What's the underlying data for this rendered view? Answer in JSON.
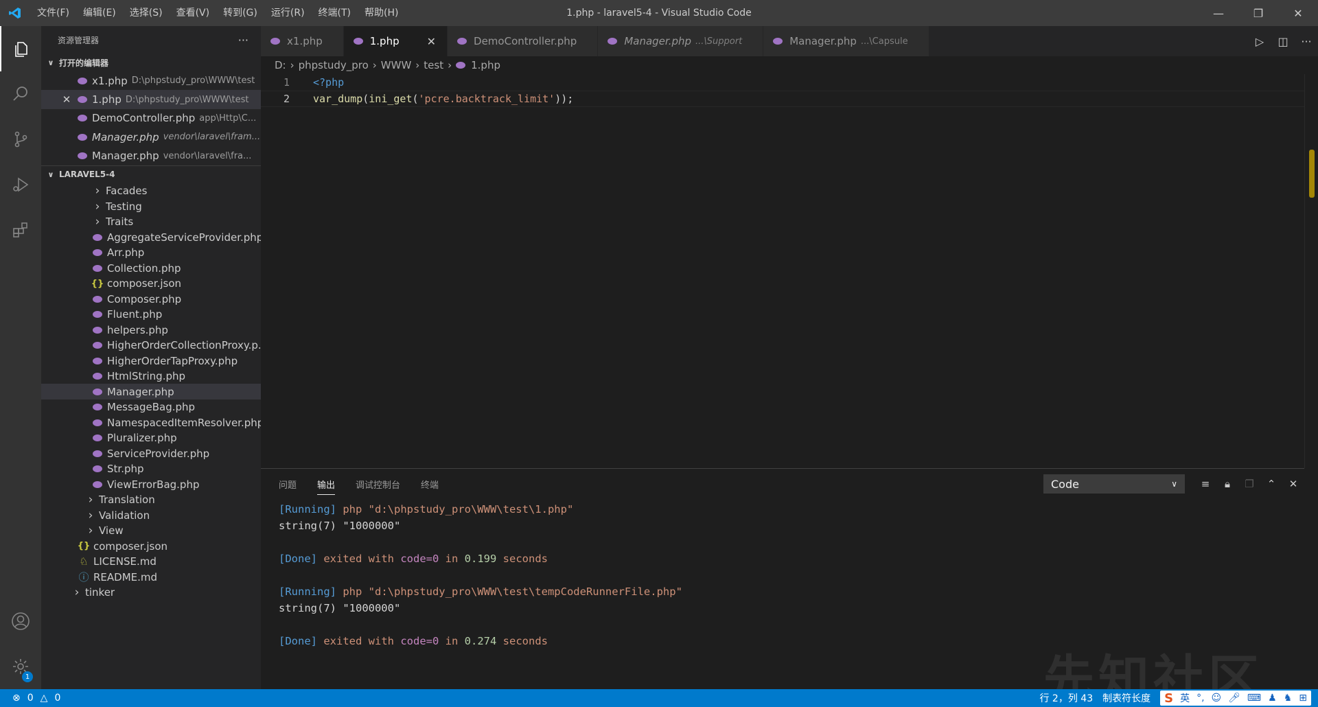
{
  "titlebar": {
    "menu": [
      "文件(F)",
      "编辑(E)",
      "选择(S)",
      "查看(V)",
      "转到(G)",
      "运行(R)",
      "终端(T)",
      "帮助(H)"
    ],
    "title": "1.php - laravel5-4 - Visual Studio Code"
  },
  "sidebar": {
    "header": "资源管理器",
    "open_editors_label": "打开的编辑器",
    "open_editors": [
      {
        "name": "x1.php",
        "desc": "D:\\phpstudy_pro\\WWW\\test",
        "italic": false
      },
      {
        "name": "1.php",
        "desc": "D:\\phpstudy_pro\\WWW\\test",
        "italic": false
      },
      {
        "name": "DemoController.php",
        "desc": "app\\Http\\C...",
        "italic": false
      },
      {
        "name": "Manager.php",
        "desc": "vendor\\laravel\\fram...",
        "italic": true
      },
      {
        "name": "Manager.php",
        "desc": "vendor\\laravel\\fra...",
        "italic": false
      }
    ],
    "project_label": "LARAVEL5-4",
    "tree": [
      {
        "name": "Facades",
        "kind": "folder",
        "indent": 1
      },
      {
        "name": "Testing",
        "kind": "folder",
        "indent": 1
      },
      {
        "name": "Traits",
        "kind": "folder",
        "indent": 1
      },
      {
        "name": "AggregateServiceProvider.php",
        "kind": "php",
        "indent": 1
      },
      {
        "name": "Arr.php",
        "kind": "php",
        "indent": 1
      },
      {
        "name": "Collection.php",
        "kind": "php",
        "indent": 1
      },
      {
        "name": "composer.json",
        "kind": "json",
        "indent": 1
      },
      {
        "name": "Composer.php",
        "kind": "php",
        "indent": 1
      },
      {
        "name": "Fluent.php",
        "kind": "php",
        "indent": 1
      },
      {
        "name": "helpers.php",
        "kind": "php",
        "indent": 1
      },
      {
        "name": "HigherOrderCollectionProxy.p...",
        "kind": "php",
        "indent": 1
      },
      {
        "name": "HigherOrderTapProxy.php",
        "kind": "php",
        "indent": 1
      },
      {
        "name": "HtmlString.php",
        "kind": "php",
        "indent": 1
      },
      {
        "name": "Manager.php",
        "kind": "php",
        "indent": 1,
        "selected": true
      },
      {
        "name": "MessageBag.php",
        "kind": "php",
        "indent": 1
      },
      {
        "name": "NamespacedItemResolver.php",
        "kind": "php",
        "indent": 1
      },
      {
        "name": "Pluralizer.php",
        "kind": "php",
        "indent": 1
      },
      {
        "name": "ServiceProvider.php",
        "kind": "php",
        "indent": 1
      },
      {
        "name": "Str.php",
        "kind": "php",
        "indent": 1
      },
      {
        "name": "ViewErrorBag.php",
        "kind": "php",
        "indent": 1
      },
      {
        "name": "Translation",
        "kind": "folder",
        "indent": 0
      },
      {
        "name": "Validation",
        "kind": "folder",
        "indent": 0
      },
      {
        "name": "View",
        "kind": "folder",
        "indent": 0
      },
      {
        "name": "composer.json",
        "kind": "json",
        "indent": -1
      },
      {
        "name": "LICENSE.md",
        "kind": "license",
        "indent": -1
      },
      {
        "name": "README.md",
        "kind": "info",
        "indent": -1
      },
      {
        "name": "tinker",
        "kind": "folder",
        "indent": -2
      }
    ]
  },
  "tabs": [
    {
      "name": "x1.php",
      "desc": "",
      "active": false,
      "italic": false
    },
    {
      "name": "1.php",
      "desc": "",
      "active": true,
      "italic": false
    },
    {
      "name": "DemoController.php",
      "desc": "",
      "active": false,
      "italic": false
    },
    {
      "name": "Manager.php",
      "desc": "...\\Support",
      "active": false,
      "italic": true
    },
    {
      "name": "Manager.php",
      "desc": "...\\Capsule",
      "active": false,
      "italic": false
    }
  ],
  "breadcrumb": [
    "D:",
    "phpstudy_pro",
    "WWW",
    "test",
    "1.php"
  ],
  "editor": {
    "lines": [
      {
        "num": "1",
        "tokens": [
          {
            "t": "<?php",
            "c": "kw"
          }
        ]
      },
      {
        "num": "2",
        "tokens": [
          {
            "t": "var_dump",
            "c": "fn"
          },
          {
            "t": "(",
            "c": "pl"
          },
          {
            "t": "ini_get",
            "c": "fn"
          },
          {
            "t": "(",
            "c": "pl"
          },
          {
            "t": "'pcre.backtrack_limit'",
            "c": "str"
          },
          {
            "t": "));",
            "c": "pl"
          }
        ]
      }
    ]
  },
  "panel": {
    "tabs": [
      "问题",
      "输出",
      "调试控制台",
      "终端"
    ],
    "active_tab": "输出",
    "select_value": "Code",
    "output": [
      [
        {
          "t": "[Running]",
          "c": "o-run"
        },
        {
          "t": " php \"d:\\phpstudy_pro\\WWW\\test\\1.php\"",
          "c": "o-text"
        }
      ],
      [
        {
          "t": "string(7) \"1000000\"",
          "c": "o-plain"
        }
      ],
      [],
      [
        {
          "t": "[Done]",
          "c": "o-done"
        },
        {
          "t": " exited with ",
          "c": "o-exit"
        },
        {
          "t": "code=0",
          "c": "o-code"
        },
        {
          "t": " in ",
          "c": "o-exit"
        },
        {
          "t": "0.199",
          "c": "o-num"
        },
        {
          "t": " seconds",
          "c": "o-exit"
        }
      ],
      [],
      [
        {
          "t": "[Running]",
          "c": "o-run"
        },
        {
          "t": " php \"d:\\phpstudy_pro\\WWW\\test\\tempCodeRunnerFile.php\"",
          "c": "o-text"
        }
      ],
      [
        {
          "t": "string(7) \"1000000\"",
          "c": "o-plain"
        }
      ],
      [],
      [
        {
          "t": "[Done]",
          "c": "o-done"
        },
        {
          "t": " exited with ",
          "c": "o-exit"
        },
        {
          "t": "code=0",
          "c": "o-code"
        },
        {
          "t": " in ",
          "c": "o-exit"
        },
        {
          "t": "0.274",
          "c": "o-num"
        },
        {
          "t": " seconds",
          "c": "o-exit"
        }
      ]
    ]
  },
  "statusbar": {
    "errors": "0",
    "warnings": "0",
    "position": "行 2，列 43",
    "indent": "制表符长度",
    "ime_lang": "英"
  },
  "watermark": "先知社区",
  "badge_count": "1",
  "colors": {
    "accent": "#007acc",
    "php_icon": "#a074c4"
  }
}
